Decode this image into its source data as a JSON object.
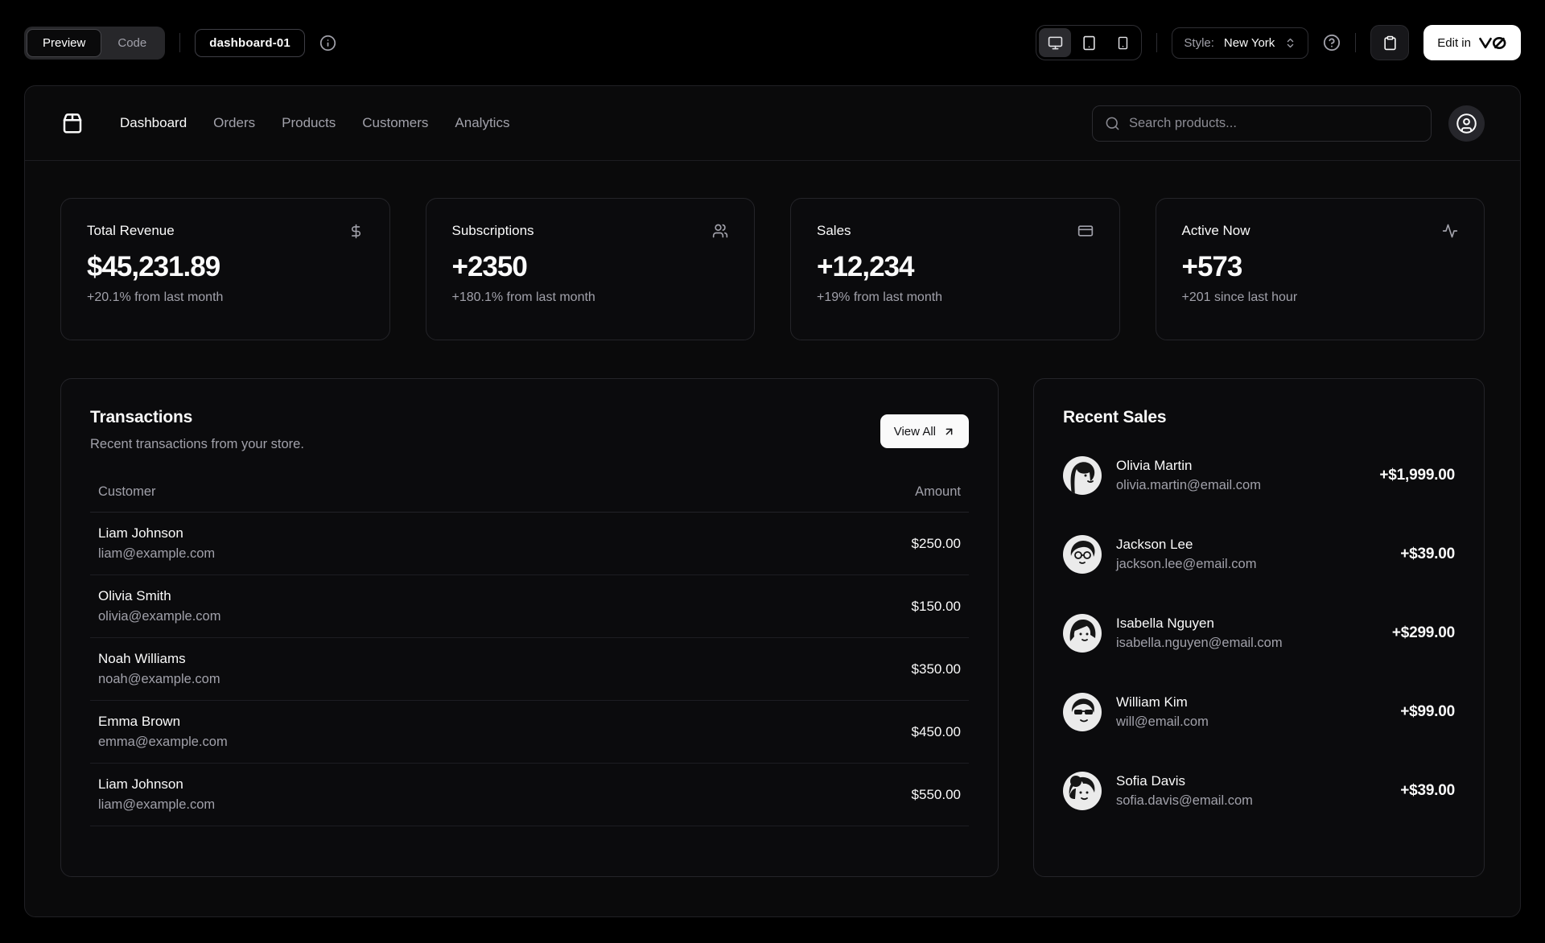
{
  "toolbar": {
    "view_tabs": {
      "preview": "Preview",
      "code": "Code"
    },
    "block_badge": "dashboard-01",
    "style": {
      "label": "Style:",
      "value": "New York"
    },
    "edit_button": {
      "text": "Edit in",
      "logo": "v0"
    },
    "icons": [
      "monitor-icon",
      "tablet-icon",
      "smartphone-icon",
      "info-icon",
      "help-icon",
      "clipboard-icon",
      "chevrons-up-down-icon"
    ]
  },
  "header": {
    "brand_icon": "package-icon",
    "nav": [
      {
        "label": "Dashboard",
        "active": true
      },
      {
        "label": "Orders",
        "active": false
      },
      {
        "label": "Products",
        "active": false
      },
      {
        "label": "Customers",
        "active": false
      },
      {
        "label": "Analytics",
        "active": false
      }
    ],
    "search_placeholder": "Search products...",
    "account_icon": "user-circle-icon"
  },
  "stats": [
    {
      "title": "Total Revenue",
      "icon": "dollar-sign-icon",
      "value": "$45,231.89",
      "change": "+20.1% from last month"
    },
    {
      "title": "Subscriptions",
      "icon": "users-icon",
      "value": "+2350",
      "change": "+180.1% from last month"
    },
    {
      "title": "Sales",
      "icon": "credit-card-icon",
      "value": "+12,234",
      "change": "+19% from last month"
    },
    {
      "title": "Active Now",
      "icon": "activity-icon",
      "value": "+573",
      "change": "+201 since last hour"
    }
  ],
  "transactions": {
    "title": "Transactions",
    "subtitle": "Recent transactions from your store.",
    "view_all": "View All",
    "columns": {
      "customer": "Customer",
      "amount": "Amount"
    },
    "rows": [
      {
        "name": "Liam Johnson",
        "email": "liam@example.com",
        "amount": "$250.00"
      },
      {
        "name": "Olivia Smith",
        "email": "olivia@example.com",
        "amount": "$150.00"
      },
      {
        "name": "Noah Williams",
        "email": "noah@example.com",
        "amount": "$350.00"
      },
      {
        "name": "Emma Brown",
        "email": "emma@example.com",
        "amount": "$450.00"
      },
      {
        "name": "Liam Johnson",
        "email": "liam@example.com",
        "amount": "$550.00"
      }
    ]
  },
  "recent_sales": {
    "title": "Recent Sales",
    "items": [
      {
        "name": "Olivia Martin",
        "email": "olivia.martin@email.com",
        "amount": "+$1,999.00"
      },
      {
        "name": "Jackson Lee",
        "email": "jackson.lee@email.com",
        "amount": "+$39.00"
      },
      {
        "name": "Isabella Nguyen",
        "email": "isabella.nguyen@email.com",
        "amount": "+$299.00"
      },
      {
        "name": "William Kim",
        "email": "will@email.com",
        "amount": "+$99.00"
      },
      {
        "name": "Sofia Davis",
        "email": "sofia.davis@email.com",
        "amount": "+$39.00"
      }
    ]
  },
  "colors": {
    "page_bg": "#000000",
    "panel_bg": "#0a0a0b",
    "card_border": "#242429",
    "muted_text": "#a1a1aa",
    "primary_text": "#fafafa",
    "accent_button_bg": "#fafafa"
  }
}
